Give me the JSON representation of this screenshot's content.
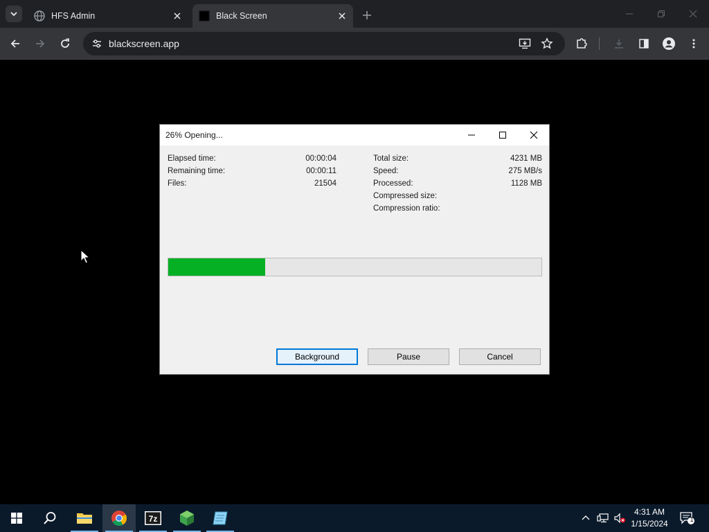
{
  "browser": {
    "tabs": [
      {
        "title": "HFS Admin",
        "active": false
      },
      {
        "title": "Black Screen",
        "active": true
      }
    ],
    "url": "blackscreen.app"
  },
  "dialog": {
    "title": "26% Opening...",
    "progress_percent": 26,
    "stats_left": [
      {
        "label": "Elapsed time:",
        "value": "00:00:04"
      },
      {
        "label": "Remaining time:",
        "value": "00:00:11"
      },
      {
        "label": "Files:",
        "value": "21504"
      }
    ],
    "stats_right": [
      {
        "label": "Total size:",
        "value": "4231 MB"
      },
      {
        "label": "Speed:",
        "value": "275 MB/s"
      },
      {
        "label": "Processed:",
        "value": "1128 MB"
      },
      {
        "label": "Compressed size:",
        "value": ""
      },
      {
        "label": "Compression ratio:",
        "value": ""
      }
    ],
    "buttons": {
      "background": "Background",
      "pause": "Pause",
      "cancel": "Cancel"
    }
  },
  "taskbar": {
    "apps": [
      "start-icon",
      "search-icon",
      "file-explorer-icon",
      "chrome-icon",
      "7zip-icon",
      "green-cube-app-icon",
      "notepad-app-icon"
    ],
    "clock": {
      "time": "4:31 AM",
      "date": "1/15/2024"
    },
    "notifications_count": "1"
  },
  "colors": {
    "progress_fill": "#06b025",
    "chrome_dark": "#202124",
    "chrome_toolbar": "#35363a",
    "taskbar": "#0b1a2b"
  }
}
